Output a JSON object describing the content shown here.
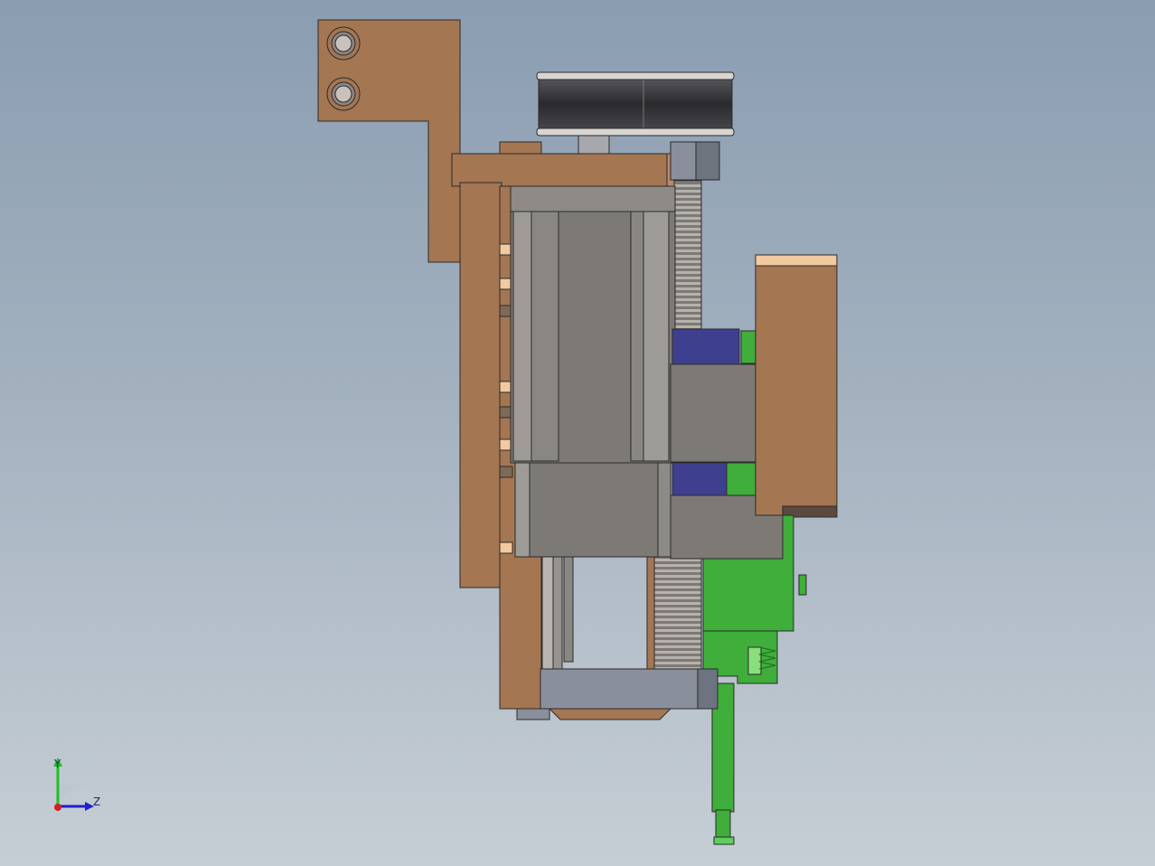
{
  "view": {
    "background_top": "#8a9db1",
    "background_bottom": "#c6ced5"
  },
  "colors": {
    "bronze": "#a47652",
    "bronze_light": "#b8896a",
    "bronze_highlight": "#f2caa0",
    "steel_gray": "#7d7a76",
    "steel_light": "#9e9b97",
    "slate": "#8a8f9c",
    "slate_dark": "#6e7380",
    "indigo": "#3f3f8f",
    "green": "#3fae3a",
    "green_light": "#5cd05a",
    "black": "#2a2a2e",
    "screw": "#a8a49f"
  },
  "triad": {
    "y_label": "Y",
    "z_label": "Z",
    "y_color": "#20c020",
    "z_color": "#2020d0",
    "x_color": "#d02020"
  }
}
